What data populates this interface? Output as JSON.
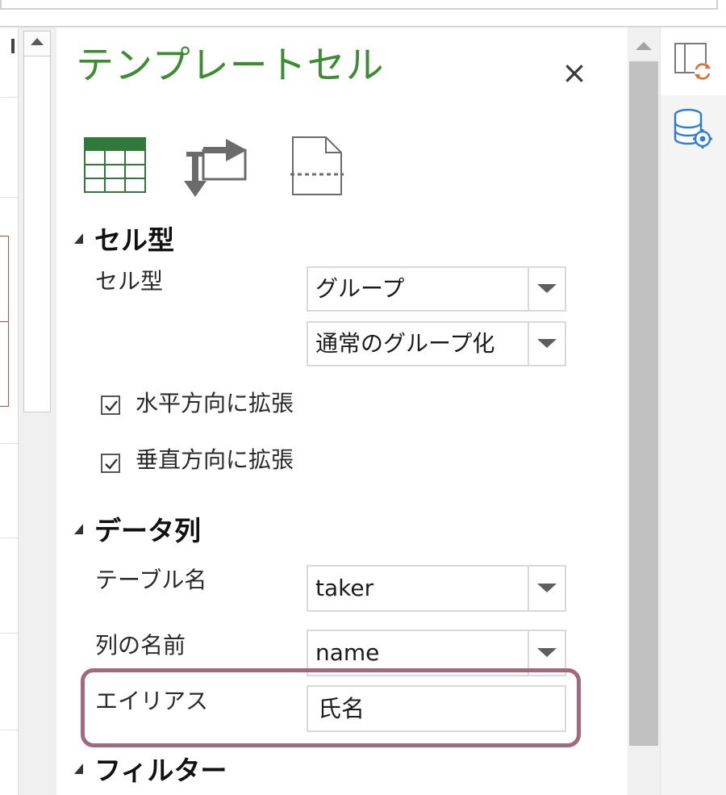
{
  "panel": {
    "title": "テンプレートセル"
  },
  "toolbar": {
    "items": [
      {
        "icon": "table-icon"
      },
      {
        "icon": "swap-direction-icon"
      },
      {
        "icon": "page-break-icon"
      }
    ]
  },
  "sections": {
    "cell_type": {
      "heading": "セル型",
      "label": "セル型",
      "dropdown1_value": "グループ",
      "dropdown2_value": "通常のグループ化",
      "checkbox_horizontal": {
        "label": "水平方向に拡張",
        "checked": true
      },
      "checkbox_vertical": {
        "label": "垂直方向に拡張",
        "checked": true
      }
    },
    "data_column": {
      "heading": "データ列",
      "table_label": "テーブル名",
      "table_value": "taker",
      "column_label": "列の名前",
      "column_value": "name",
      "alias_label": "エイリアス",
      "alias_value": "氏名"
    },
    "filter": {
      "heading": "フィルター"
    }
  },
  "side_tabs": [
    {
      "icon": "template-cell-refresh-icon",
      "active": true
    },
    {
      "icon": "database-settings-icon",
      "active": false
    }
  ],
  "colors": {
    "title": "#3b8e2f",
    "accent_orange": "#e46a2b",
    "accent_blue": "#2f7fcf",
    "highlight_border": "#a3687e",
    "table_icon_green": "#2f7a3a"
  }
}
